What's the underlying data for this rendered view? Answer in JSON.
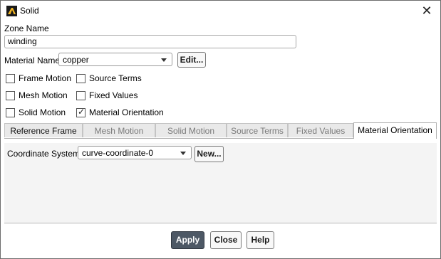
{
  "window": {
    "title": "Solid",
    "icon": "ansys-app-icon",
    "close_icon": "close-icon",
    "close_glyph": "✕"
  },
  "zone": {
    "label": "Zone Name",
    "value": "winding"
  },
  "material": {
    "label": "Material Name",
    "value": "copper",
    "edit_label": "Edit..."
  },
  "checkboxes": [
    {
      "label": "Frame Motion",
      "checked": false
    },
    {
      "label": "Source Terms",
      "checked": false
    },
    {
      "label": "Mesh Motion",
      "checked": false
    },
    {
      "label": "Fixed Values",
      "checked": false
    },
    {
      "label": "Solid Motion",
      "checked": false
    },
    {
      "label": "Material Orientation",
      "checked": true
    }
  ],
  "tabs": [
    {
      "label": "Reference Frame",
      "enabled": true
    },
    {
      "label": "Mesh Motion",
      "enabled": false
    },
    {
      "label": "Solid Motion",
      "enabled": false
    },
    {
      "label": "Source Terms",
      "enabled": false
    },
    {
      "label": "Fixed Values",
      "enabled": false
    },
    {
      "label": "Material Orientation",
      "enabled": true,
      "active": true
    }
  ],
  "coord": {
    "label": "Coordinate System",
    "value": "curve-coordinate-0",
    "new_label": "New..."
  },
  "footer": {
    "apply": "Apply",
    "close": "Close",
    "help": "Help"
  },
  "colors": {
    "primary_button": "#4d5865",
    "panel_bg": "#f4f4f4"
  }
}
